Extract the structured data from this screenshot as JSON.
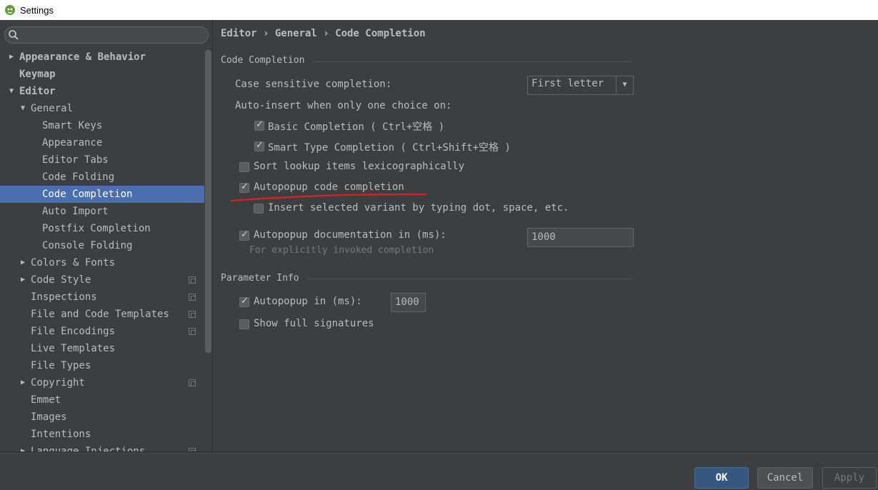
{
  "window": {
    "title": "Settings"
  },
  "search": {
    "placeholder": ""
  },
  "tree": [
    {
      "label": "Appearance & Behavior",
      "level": 0,
      "arrow": "▶",
      "bold": true
    },
    {
      "label": "Keymap",
      "level": 0,
      "arrow": "",
      "bold": true
    },
    {
      "label": "Editor",
      "level": 0,
      "arrow": "▼",
      "bold": true
    },
    {
      "label": "General",
      "level": 1,
      "arrow": "▼"
    },
    {
      "label": "Smart Keys",
      "level": 2,
      "arrow": ""
    },
    {
      "label": "Appearance",
      "level": 2,
      "arrow": ""
    },
    {
      "label": "Editor Tabs",
      "level": 2,
      "arrow": ""
    },
    {
      "label": "Code Folding",
      "level": 2,
      "arrow": ""
    },
    {
      "label": "Code Completion",
      "level": 2,
      "arrow": "",
      "selected": true
    },
    {
      "label": "Auto Import",
      "level": 2,
      "arrow": ""
    },
    {
      "label": "Postfix Completion",
      "level": 2,
      "arrow": ""
    },
    {
      "label": "Console Folding",
      "level": 2,
      "arrow": ""
    },
    {
      "label": "Colors & Fonts",
      "level": 1,
      "arrow": "▶"
    },
    {
      "label": "Code Style",
      "level": 1,
      "arrow": "▶",
      "project": true
    },
    {
      "label": "Inspections",
      "level": 1,
      "arrow": "",
      "project": true
    },
    {
      "label": "File and Code Templates",
      "level": 1,
      "arrow": "",
      "project": true
    },
    {
      "label": "File Encodings",
      "level": 1,
      "arrow": "",
      "project": true
    },
    {
      "label": "Live Templates",
      "level": 1,
      "arrow": ""
    },
    {
      "label": "File Types",
      "level": 1,
      "arrow": ""
    },
    {
      "label": "Copyright",
      "level": 1,
      "arrow": "▶",
      "project": true
    },
    {
      "label": "Emmet",
      "level": 1,
      "arrow": ""
    },
    {
      "label": "Images",
      "level": 1,
      "arrow": ""
    },
    {
      "label": "Intentions",
      "level": 1,
      "arrow": ""
    },
    {
      "label": "Language Injections",
      "level": 1,
      "arrow": "▶",
      "project": true
    }
  ],
  "breadcrumb": "Editor › General › Code Completion",
  "code_completion": {
    "section_title": "Code Completion",
    "case_sensitive_label": "Case sensitive completion:",
    "case_sensitive_value": "First letter",
    "auto_insert_label": "Auto-insert when only one choice on:",
    "basic_completion": {
      "label": "Basic Completion ( Ctrl+空格 )",
      "checked": true
    },
    "smart_type_completion": {
      "label": "Smart Type Completion ( Ctrl+Shift+空格 )",
      "checked": true
    },
    "sort_lexicographically": {
      "label": "Sort lookup items lexicographically",
      "checked": false
    },
    "autopopup_code_completion": {
      "label": "Autopopup code completion",
      "checked": true
    },
    "insert_selected_variant": {
      "label": "Insert selected variant by typing dot, space, etc.",
      "checked": false
    },
    "autopopup_documentation": {
      "label": "Autopopup documentation in (ms):",
      "checked": true,
      "value": "1000"
    },
    "documentation_hint": "For explicitly invoked completion"
  },
  "parameter_info": {
    "section_title": "Parameter Info",
    "autopopup": {
      "label": "Autopopup in (ms):",
      "checked": true,
      "value": "1000"
    },
    "show_full_signatures": {
      "label": "Show full signatures",
      "checked": false
    }
  },
  "footer": {
    "ok": "OK",
    "cancel": "Cancel",
    "apply": "Apply"
  },
  "colors": {
    "selection": "#4b6eaf",
    "annotation": "#e02020",
    "background": "#3c3f41"
  }
}
